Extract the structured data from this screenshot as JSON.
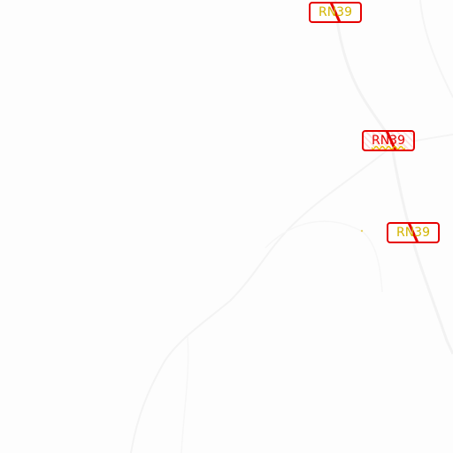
{
  "map": {
    "background_color": "#fdfdfd",
    "road_color": "#f0f0f0",
    "shield_border_color": "#e60000",
    "shield_text_color": "#d2b400",
    "shields": [
      {
        "label": "RN39"
      },
      {
        "label": "RN39"
      },
      {
        "label": "RN39"
      }
    ]
  }
}
